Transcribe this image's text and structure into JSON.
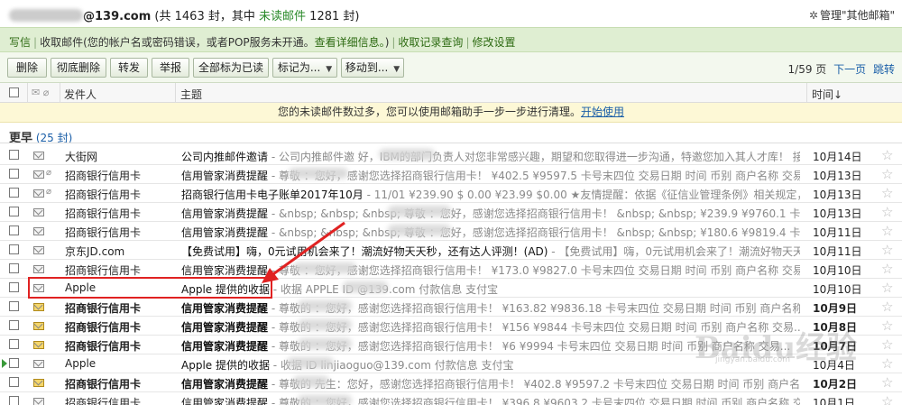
{
  "header": {
    "account_suffix": "@139.com",
    "total_prefix": "(共",
    "total": "1463",
    "total_unit": "封，其中",
    "unread_label": "未读邮件",
    "unread": "1281",
    "unread_unit": "封)",
    "manage_label": "管理\"其他邮箱\""
  },
  "notice": {
    "write": "写信",
    "receive_error": "收取邮件(您的帐户名或密码错误，或者POP服务未开通。",
    "view_detail": "查看详细信息。",
    "receive_error_close": ")",
    "history": "收取记录查询",
    "settings": "修改设置"
  },
  "toolbar": {
    "delete": "删除",
    "delete_permanent": "彻底删除",
    "forward": "转发",
    "report": "举报",
    "mark_all_read": "全部标为已读",
    "mark_as": "标记为...",
    "move_to": "移动到...",
    "page_info": "1/59 页",
    "next_page": "下一页",
    "jump": "跳转"
  },
  "columns": {
    "from": "发件人",
    "subject": "主题",
    "time": "时间↓"
  },
  "clean_notice": {
    "text": "您的未读邮件数过多，您可以使用邮箱助手一步一步进行清理。",
    "link": "开始使用"
  },
  "group": {
    "label": "更早",
    "count": "(25 封)"
  },
  "emails": [
    {
      "from": "大街网",
      "subject": "公司内推邮件邀请",
      "preview": " - 公司内推邮件邀                好，IBM的部门负责人对您非常感兴趣，期望和您取得进一步沟通，特邀您加入其人才库！ 接...",
      "date": "10月14日",
      "bold": false,
      "unread": false,
      "attach": false
    },
    {
      "from": "招商银行信用卡",
      "subject": "信用管家消费提醒",
      "preview": " - 尊敬                 ：您好，感谢您选择招商银行信用卡！ ¥402.5 ¥9597.5 卡号末四位 交易日期 时间 币别 商户名称 交易...",
      "date": "10月13日",
      "bold": false,
      "unread": false,
      "attach": true
    },
    {
      "from": "招商银行信用卡",
      "subject": "招商银行信用卡电子账单2017年10月",
      "preview": " - 11/01 ¥239.90 $ 0.00 ¥23.99 $0.00 ★友情提醒：依据《征信业管理条例》相关规定，我行会如实...",
      "date": "10月13日",
      "bold": false,
      "unread": false,
      "attach": true
    },
    {
      "from": "招商银行信用卡",
      "subject": "信用管家消费提醒",
      "preview": " - &nbsp; &nbsp; &nbsp; 尊敬              ：您好，感谢您选择招商银行信用卡！ &nbsp; &nbsp; ¥239.9 ¥9760.1 卡...",
      "date": "10月13日",
      "bold": false,
      "unread": false,
      "attach": false
    },
    {
      "from": "招商银行信用卡",
      "subject": "信用管家消费提醒",
      "preview": " - &nbsp; &nbsp; &nbsp; 尊敬              ：您好，感谢您选择招商银行信用卡！ &nbsp; &nbsp; ¥180.6 ¥9819.4 卡...",
      "date": "10月11日",
      "bold": false,
      "unread": false,
      "attach": false
    },
    {
      "from": "京东JD.com",
      "subject": "【免费试用】嗨，0元试用机会来了！潮流好物天天秒，还有达人评测！(AD)",
      "preview": " - 【免费试用】嗨，0元试用机会来了！潮流好物天天秒，还有达人评...",
      "date": "10月11日",
      "bold": false,
      "unread": false,
      "attach": false
    },
    {
      "from": "招商银行信用卡",
      "subject": "信用管家消费提醒",
      "preview": " - 尊敬                 ：您好，感谢您选择招商银行信用卡！ ¥173.0 ¥9827.0 卡号末四位 交易日期 时间 币别 商户名称 交易...",
      "date": "10月10日",
      "bold": false,
      "unread": false,
      "attach": false
    },
    {
      "from": "Apple",
      "subject": "Apple 提供的收据",
      "preview": " - 收据 APPLE ID              @139.com 付款信息 支付宝",
      "date": "10月10日",
      "bold": false,
      "unread": false,
      "attach": false
    },
    {
      "from": "招商银行信用卡",
      "subject": "信用管家消费提醒",
      "preview": " - 尊敬的              ：您好，感谢您选择招商银行信用卡！ ¥163.82 ¥9836.18 卡号末四位 交易日期 时间 币别 商户名称 交易...",
      "date": "10月9日",
      "bold": true,
      "unread": true,
      "attach": false
    },
    {
      "from": "招商银行信用卡",
      "subject": "信用管家消费提醒",
      "preview": " - 尊敬的              ：您好，感谢您选择招商银行信用卡！ ¥156 ¥9844 卡号末四位 交易日期 时间 币别 商户名称 交易...",
      "date": "10月8日",
      "bold": true,
      "unread": true,
      "attach": false
    },
    {
      "from": "招商银行信用卡",
      "subject": "信用管家消费提醒",
      "preview": " - 尊敬的              ：您好，感谢您选择招商银行信用卡！ ¥6 ¥9994 卡号末四位 交易日期 时间 币别 商户名称 交易...",
      "date": "10月7日",
      "bold": true,
      "unread": true,
      "attach": false
    },
    {
      "from": "Apple",
      "subject": "Apple 提供的收据",
      "preview": " - 收据              ID linjiaoguo@139.com 付款信息 支付宝",
      "date": "10月4日",
      "bold": false,
      "unread": false,
      "attach": false
    },
    {
      "from": "招商银行信用卡",
      "subject": "信用管家消费提醒",
      "preview": " - 尊敬的         先生：您好，感谢您选择招商银行信用卡！ ¥402.8 ¥9597.2 卡号末四位 交易日期 时间 币别 商户名称 交易...",
      "date": "10月2日",
      "bold": true,
      "unread": true,
      "attach": false
    },
    {
      "from": "招商银行信用卡",
      "subject": "信用管家消费提醒",
      "preview": " - 尊敬的              ：您好，感谢您选择招商银行信用卡！ ¥396.8 ¥9603.2 卡号末四位 交易日期 时间 币别 商户名称 交易...",
      "date": "10月1日",
      "bold": false,
      "unread": false,
      "attach": false
    }
  ],
  "watermark": {
    "logo": "Baidu经验",
    "url": "jingyan.baidu.com"
  },
  "colors": {
    "notice_bg": "#dfeed2",
    "unread_green": "#2a8a2a",
    "highlight_red": "#e02222",
    "link_blue": "#1b5fa8"
  }
}
